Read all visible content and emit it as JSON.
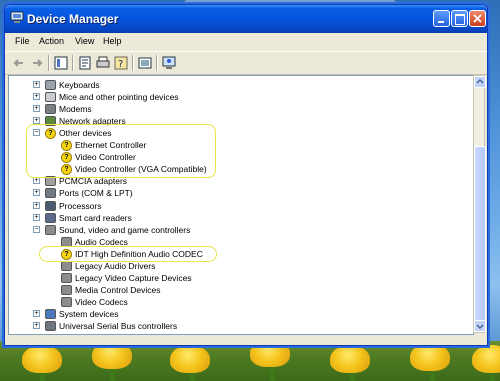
{
  "window": {
    "title": "Device Manager",
    "title_icon": "device-manager-icon"
  },
  "menu": {
    "items": [
      "File",
      "Action",
      "View",
      "Help"
    ]
  },
  "toolbar": {
    "icons": [
      "back-arrow-icon",
      "forward-arrow-icon",
      "view-icon",
      "properties-icon",
      "print-icon",
      "help-icon",
      "refresh-icon",
      "scan-hardware-icon"
    ]
  },
  "tree": {
    "items": [
      {
        "label": "Keyboards",
        "icon": "keyboard-icon",
        "expander": "+"
      },
      {
        "label": "Mice and other pointing devices",
        "icon": "mouse-icon",
        "expander": "+"
      },
      {
        "label": "Modems",
        "icon": "modem-icon",
        "expander": "+"
      },
      {
        "label": "Network adapters",
        "icon": "network-adapter-icon",
        "expander": "+"
      },
      {
        "label": "Other devices",
        "icon": "unknown-device-icon",
        "expander": "−"
      },
      {
        "label": "Ethernet Controller",
        "icon": "unknown-device-icon",
        "child": true
      },
      {
        "label": "Video Controller",
        "icon": "unknown-device-icon",
        "child": true
      },
      {
        "label": "Video Controller (VGA Compatible)",
        "icon": "unknown-device-icon",
        "child": true
      },
      {
        "label": "PCMCIA adapters",
        "icon": "pcmcia-icon",
        "expander": "+"
      },
      {
        "label": "Ports (COM & LPT)",
        "icon": "port-icon",
        "expander": "+"
      },
      {
        "label": "Processors",
        "icon": "processor-icon",
        "expander": "+"
      },
      {
        "label": "Smart card readers",
        "icon": "smart-card-icon",
        "expander": "+"
      },
      {
        "label": "Sound, video and game controllers",
        "icon": "sound-icon",
        "expander": "−"
      },
      {
        "label": "Audio Codecs",
        "icon": "sound-icon",
        "child": true
      },
      {
        "label": "IDT High Definition Audio CODEC",
        "icon": "unknown-device-icon",
        "child": true
      },
      {
        "label": "Legacy Audio Drivers",
        "icon": "sound-icon",
        "child": true
      },
      {
        "label": "Legacy Video Capture Devices",
        "icon": "sound-icon",
        "child": true
      },
      {
        "label": "Media Control Devices",
        "icon": "sound-icon",
        "child": true
      },
      {
        "label": "Video Codecs",
        "icon": "sound-icon",
        "child": true
      },
      {
        "label": "System devices",
        "icon": "system-icon",
        "expander": "+"
      },
      {
        "label": "Universal Serial Bus controllers",
        "icon": "usb-icon",
        "expander": "+"
      }
    ]
  },
  "colors": {
    "titlebar": "#0653db",
    "highlight": "#e8e545",
    "warning": "#f7d617"
  }
}
